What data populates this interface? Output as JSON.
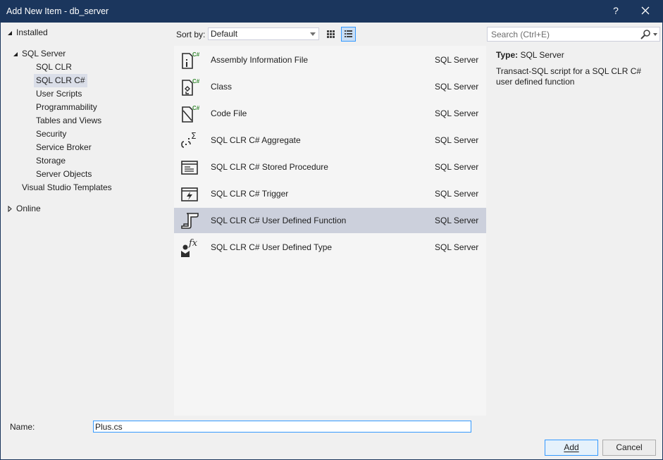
{
  "window": {
    "title": "Add New Item - db_server",
    "help_label": "?"
  },
  "tree": {
    "installed": "Installed",
    "sql_server": "SQL Server",
    "children": [
      "SQL CLR",
      "SQL CLR C#",
      "User Scripts",
      "Programmability",
      "Tables and Views",
      "Security",
      "Service Broker",
      "Storage",
      "Server Objects"
    ],
    "vs_templates": "Visual Studio Templates",
    "online": "Online",
    "selected": "SQL CLR C#"
  },
  "toolbar": {
    "sort_label": "Sort by:",
    "sort_value": "Default"
  },
  "search": {
    "placeholder": "Search (Ctrl+E)"
  },
  "items": [
    {
      "name": "Assembly Information File",
      "category": "SQL Server",
      "icon": "assembly-info-icon"
    },
    {
      "name": "Class",
      "category": "SQL Server",
      "icon": "class-icon"
    },
    {
      "name": "Code File",
      "category": "SQL Server",
      "icon": "code-file-icon"
    },
    {
      "name": "SQL CLR C# Aggregate",
      "category": "SQL Server",
      "icon": "aggregate-icon"
    },
    {
      "name": "SQL CLR C# Stored Procedure",
      "category": "SQL Server",
      "icon": "stored-procedure-icon"
    },
    {
      "name": "SQL CLR C# Trigger",
      "category": "SQL Server",
      "icon": "trigger-icon"
    },
    {
      "name": "SQL CLR C# User Defined Function",
      "category": "SQL Server",
      "icon": "user-defined-function-icon"
    },
    {
      "name": "SQL CLR C# User Defined Type",
      "category": "SQL Server",
      "icon": "user-defined-type-icon"
    }
  ],
  "selected_item": "SQL CLR C# User Defined Function",
  "details": {
    "type_label": "Type:",
    "type_value": "SQL Server",
    "description": "Transact-SQL script for a SQL CLR C# user defined function"
  },
  "bottom": {
    "name_label": "Name:",
    "name_value": "Plus.cs",
    "add_label": "Add",
    "cancel_label": "Cancel"
  },
  "colors": {
    "titlebar": "#1b365d",
    "accent": "#3399ff",
    "selection": "#ccd0dc",
    "csharp_badge": "#388a34"
  }
}
